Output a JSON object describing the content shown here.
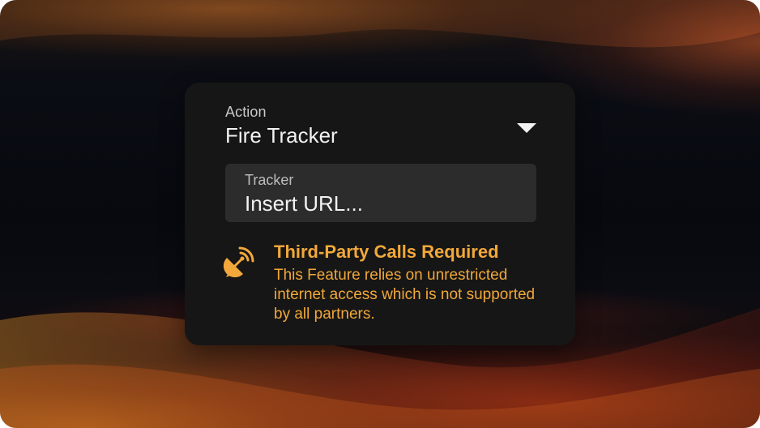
{
  "action": {
    "label": "Action",
    "value": "Fire Tracker",
    "icon": "chevron-down-icon"
  },
  "tracker": {
    "label": "Tracker",
    "value": "Insert URL..."
  },
  "warning": {
    "icon": "satellite-dish-icon",
    "title": "Third-Party Calls Required",
    "body": "This Feature relies on unrestricted internet access which is not supported by all partners.",
    "color": "#f2a83a"
  }
}
